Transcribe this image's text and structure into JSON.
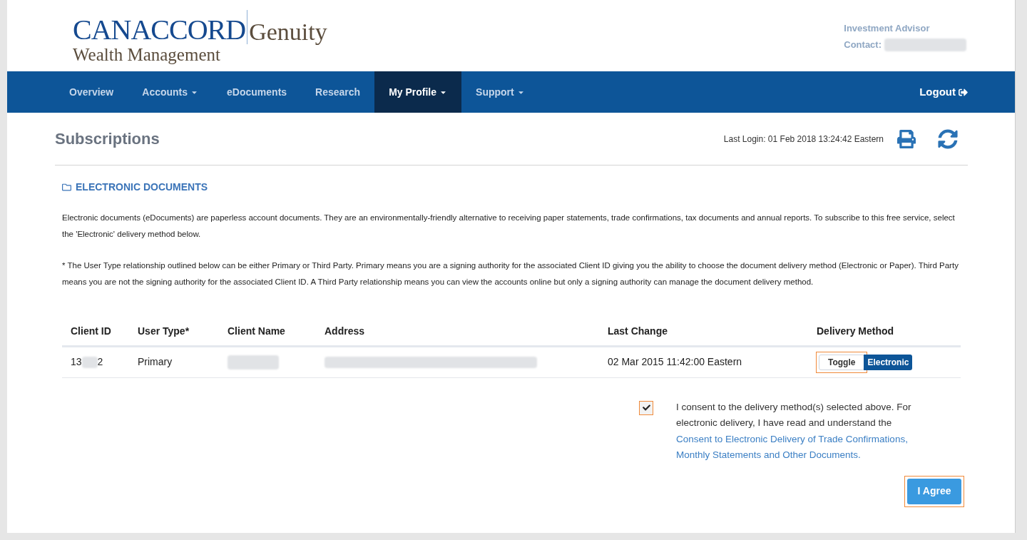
{
  "logo": {
    "brand": "CANACCORD",
    "suffix": "Genuity",
    "division": "Wealth Management"
  },
  "advisor": {
    "title": "Investment Advisor",
    "contact_label": "Contact:"
  },
  "nav": {
    "items": [
      {
        "label": "Overview",
        "dropdown": false,
        "selected": false
      },
      {
        "label": "Accounts",
        "dropdown": true,
        "selected": false
      },
      {
        "label": "eDocuments",
        "dropdown": false,
        "selected": false
      },
      {
        "label": "Research",
        "dropdown": false,
        "selected": false
      },
      {
        "label": "My Profile",
        "dropdown": true,
        "selected": true
      },
      {
        "label": "Support",
        "dropdown": true,
        "selected": false
      }
    ],
    "logout": "Logout"
  },
  "page": {
    "title": "Subscriptions",
    "last_login": "Last Login: 01 Feb 2018 13:24:42 Eastern"
  },
  "section": {
    "title": "ELECTRONIC DOCUMENTS",
    "paragraphs": [
      "Electronic documents (eDocuments) are paperless account documents. They are an environmentally-friendly alternative to receiving paper statements, trade confirmations, tax documents and annual reports. To subscribe to this free service, select the 'Electronic' delivery method below.",
      "* The User Type relationship outlined below can be either Primary or Third Party. Primary means you are a signing authority for the associated Client ID giving you the ability to choose the document delivery method (Electronic or Paper). Third Party means you are not the signing authority for the associated Client ID. A Third Party relationship means you can view the accounts online but only a signing authority can manage the document delivery method."
    ]
  },
  "table": {
    "columns": [
      "Client ID",
      "User Type*",
      "Client Name",
      "Address",
      "Last Change",
      "Delivery Method"
    ],
    "rows": [
      {
        "client_id_start": "13",
        "client_id_end": "2",
        "user_type": "Primary",
        "last_change": "02 Mar 2015 11:42:00 Eastern",
        "toggle": {
          "label": "Toggle",
          "highlighted": true
        },
        "method": "Electronic"
      }
    ]
  },
  "consent": {
    "checked": true,
    "highlighted": true,
    "text": "I consent to the delivery method(s) selected above. For electronic delivery, I have read and understand the",
    "link": "Consent to Electronic Delivery of Trade Confirmations, Monthly Statements and Other Documents."
  },
  "agree_button": {
    "label": "I Agree",
    "highlighted": true
  }
}
